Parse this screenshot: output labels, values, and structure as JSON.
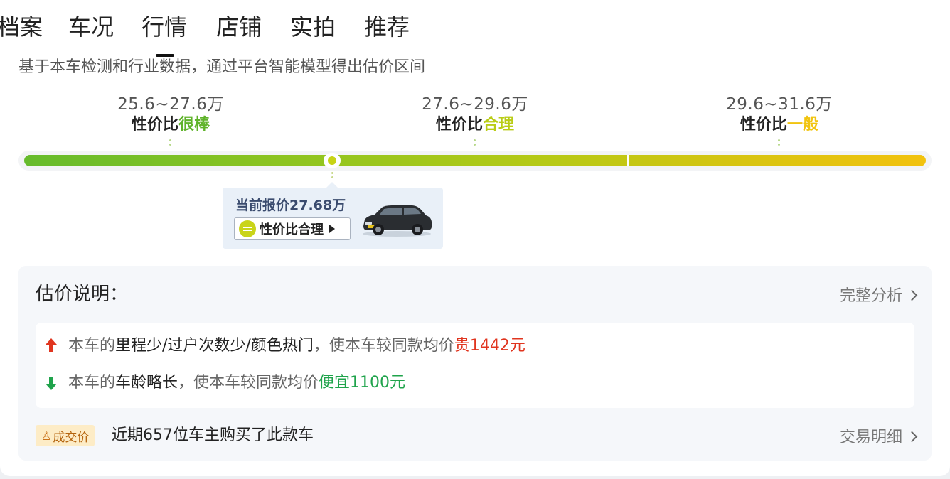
{
  "tabs": [
    {
      "label": "档案"
    },
    {
      "label": "车况"
    },
    {
      "label": "行情"
    },
    {
      "label": "店铺"
    },
    {
      "label": "实拍"
    },
    {
      "label": "推荐"
    }
  ],
  "active_tab": "行情",
  "description": "基于本车检测和行业数据，通过平台智能模型得出估价区间",
  "ranges": [
    {
      "price": "25.6~27.6万",
      "label_prefix": "性价比",
      "label_level": "很棒",
      "color": "#5fb32a"
    },
    {
      "price": "27.6~29.6万",
      "label_prefix": "性价比",
      "label_level": "合理",
      "color": "#b9cc15"
    },
    {
      "price": "29.6~31.6万",
      "label_prefix": "性价比",
      "label_level": "一般",
      "color": "#f1c40f"
    }
  ],
  "scale": {
    "min": 25.6,
    "max": 31.6,
    "current": 27.68
  },
  "popup": {
    "title": "当前报价27.68万",
    "button_label": "性价比合理",
    "car_image": "black SUV"
  },
  "explanation": {
    "title": "估价说明：",
    "link_label": "完整分析",
    "reasons": [
      {
        "direction": "up",
        "prefix": "本车的",
        "factors": "里程少/过户次数少/颜色热门",
        "middle": "，使本车较同款均价",
        "result": "贵1442元"
      },
      {
        "direction": "down",
        "prefix": "本车的",
        "factors": "车龄略长",
        "middle": "，使本车较同款均价",
        "result": "便宜1100元"
      }
    ],
    "deal_badge": "成交价",
    "deal_text": "近期657位车主购买了此款车",
    "deal_link": "交易明细"
  },
  "colors": {
    "up": "#e0351f",
    "down": "#1fa34b",
    "popup_bg": "#e9f0f8"
  }
}
